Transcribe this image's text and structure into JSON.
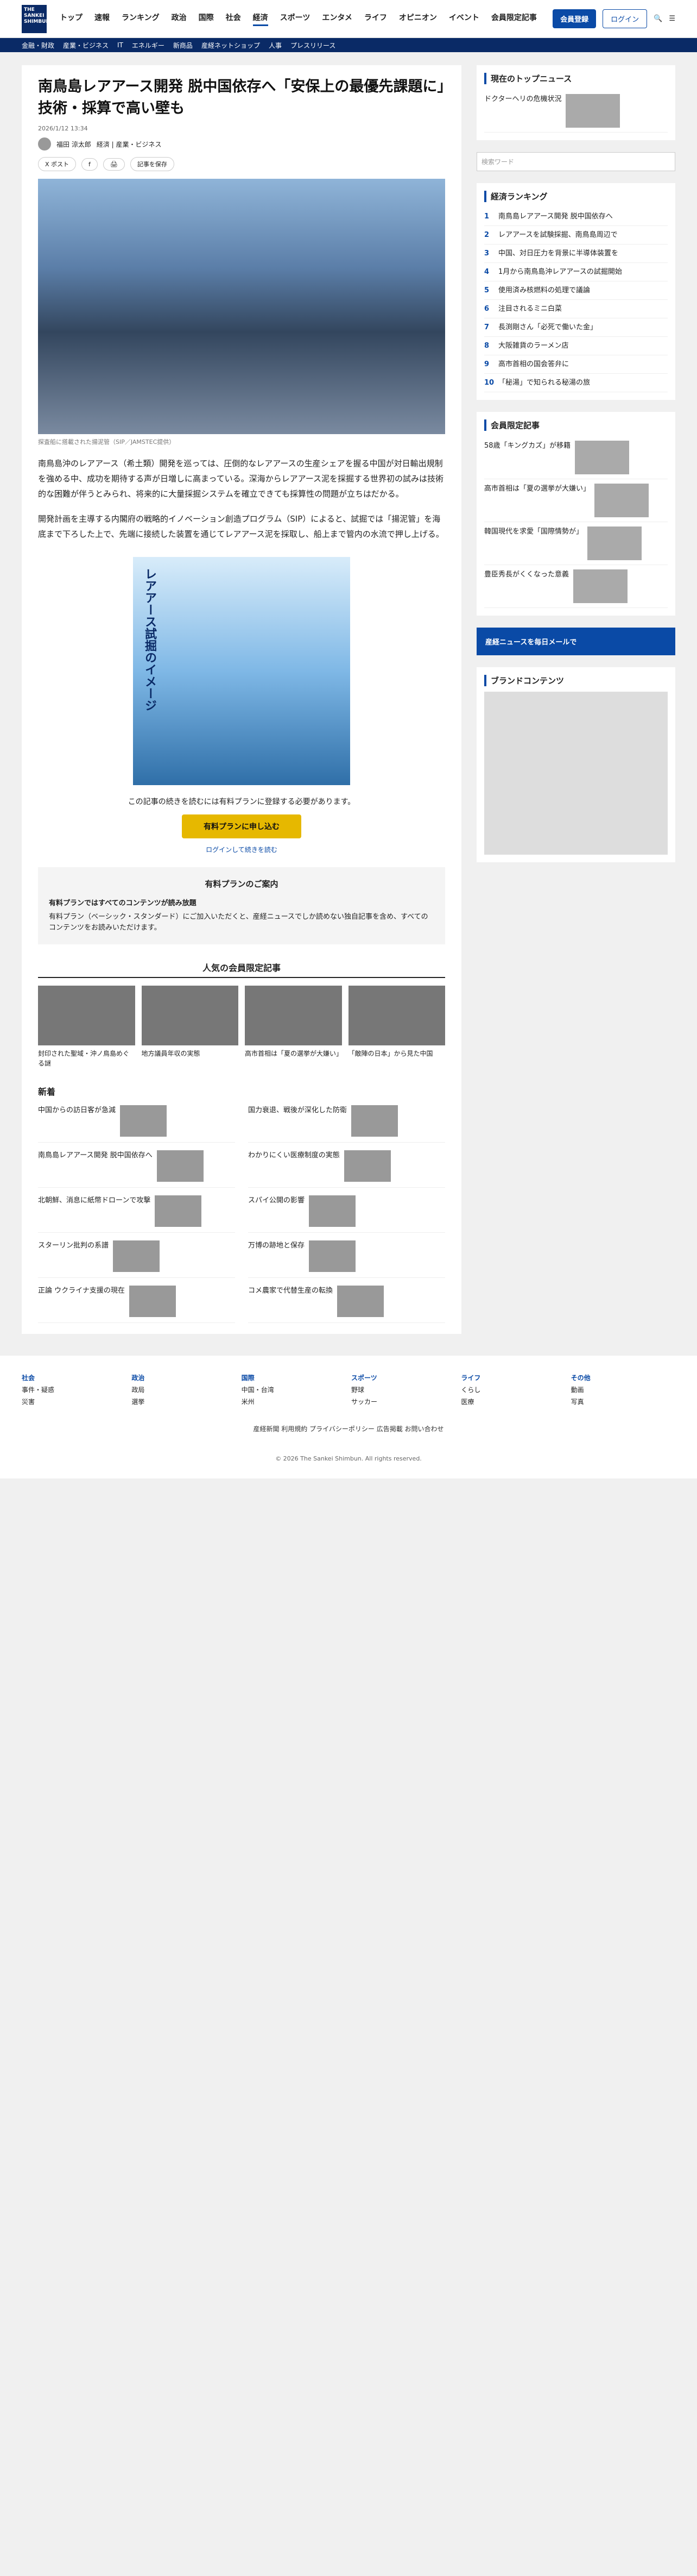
{
  "header": {
    "nav": [
      "トップ",
      "速報",
      "ランキング",
      "政治",
      "国際",
      "社会",
      "経済",
      "スポーツ",
      "エンタメ",
      "ライフ",
      "オピニオン",
      "イベント",
      "会員限定記事"
    ],
    "register": "会員登録",
    "login": "ログイン"
  },
  "subnav": [
    "金融・財政",
    "産業・ビジネス",
    "IT",
    "エネルギー",
    "新商品",
    "産経ネットショップ",
    "人事",
    "プレスリリース"
  ],
  "article": {
    "title": "南鳥島レアアース開発 脱中国依存へ「安保上の最優先課題に」技術・採算で高い壁も",
    "date": "2026/1/12 13:34",
    "author": "福田 涼太郎",
    "tags": "経済 | 産業・ビジネス",
    "caption": "探査船に搭載された揚泥管（SIP／JAMSTEC提供）",
    "p1": "南鳥島沖のレアアース（希土類）開発を巡っては、圧倒的なレアアースの生産シェアを握る中国が対日輸出規制を強める中、成功を期待する声が日増しに高まっている。深海からレアアース泥を採掘する世界初の試みは技術的な困難が伴うとみられ、将来的に大量採掘システムを確立できても採算性の問題が立ちはだかる。",
    "p2": "開発計画を主導する内閣府の戦略的イノベーション創造プログラム（SIP）によると、試掘では「揚泥管」を海底まで下ろした上で、先端に接続した装置を通じてレアアース泥を採取し、船上まで管内の水流で押し上げる。",
    "fig_label": "レアアース試掘のイメージ",
    "paywall": "この記事の続きを読むには有料プランに登録する必要があります。",
    "cta": "有料プランに申し込む",
    "login_link": "ログインして続きを読む"
  },
  "plan": {
    "title": "有料プランのご案内",
    "h": "有料プランではすべてのコンテンツが読み放題",
    "txt": "有料プラン（ベーシック・スタンダード）にご加入いただくと、産経ニュースでしか読めない独自記事を含め、すべてのコンテンツをお読みいただけます。"
  },
  "popular": {
    "title": "人気の会員限定記事",
    "items": [
      "封印された聖域・沖ノ鳥島めぐる謎",
      "地方議員年収の実態",
      "高市首相は「夏の選挙が大嫌い」",
      "「敵陣の日本」から見た中国"
    ]
  },
  "news": {
    "title": "新着",
    "items": [
      "中国からの訪日客が急減",
      "国力衰退、戦後が深化した防衛",
      "南鳥島レアアース開発 脱中国依存へ",
      "わかりにくい医療制度の実態",
      "北朝鮮、消息に紙幣ドローンで攻撃",
      "スパイ公開の影響",
      "スターリン批判の系譜",
      "万博の跡地と保存",
      "正論 ウクライナ支援の現在",
      "コメ農家で代替生産の転換"
    ]
  },
  "side": {
    "top_title": "現在のトップニュース",
    "top_item": "ドクターヘリの危機状況",
    "search_ph": "検索ワード",
    "rank_title": "経済ランキング",
    "ranks": [
      "南鳥島レアアース開発 脱中国依存へ",
      "レアアースを試験採掘、南鳥島周辺で",
      "中国、対日圧力を背景に半導体装置を",
      "1月から南鳥島沖レアアースの試掘開始",
      "使用済み核燃料の処理で議論",
      "注目されるミニ白菜",
      "長渕剛さん「必死で働いた金」",
      "大阪雑貨のラーメン店",
      "高市首相の国会答弁に",
      "「秘湯」で知られる秘湯の旅"
    ],
    "members_title": "会員限定記事",
    "members": [
      "58歳「キングカズ」が移籍",
      "高市首相は「夏の選挙が大嫌い」",
      "韓国現代を求愛「国際情勢が」",
      "豊臣秀長がくくなった意義"
    ],
    "banner": "産経ニュースを毎日メールで",
    "brand_title": "ブランドコンテンツ"
  },
  "footer": {
    "cols": [
      [
        "社会",
        "事件・疑惑",
        "災害"
      ],
      [
        "政治",
        "政局",
        "選挙"
      ],
      [
        "国際",
        "中国・台湾",
        "米州"
      ],
      [
        "スポーツ",
        "野球",
        "サッカー"
      ],
      [
        "ライフ",
        "くらし",
        "医療"
      ],
      [
        "その他",
        "動画",
        "写真"
      ]
    ],
    "links": "産経新聞 利用規約 プライバシーポリシー 広告掲載 お問い合わせ",
    "copy": "© 2026 The Sankei Shimbun. All rights reserved."
  }
}
